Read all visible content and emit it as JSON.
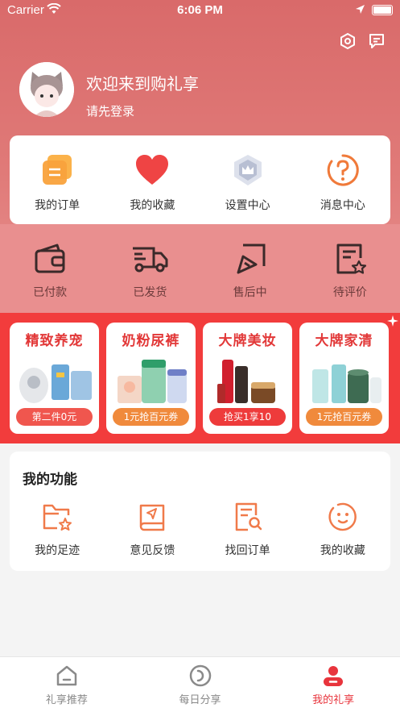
{
  "status_bar": {
    "carrier": "Carrier",
    "time": "6:06 PM"
  },
  "profile": {
    "welcome": "欢迎来到购礼享",
    "login_prompt": "请先登录"
  },
  "orders": [
    {
      "label": "我的订单",
      "icon": "orders-icon"
    },
    {
      "label": "我的收藏",
      "icon": "heart-icon"
    },
    {
      "label": "设置中心",
      "icon": "crown-shield-icon"
    },
    {
      "label": "消息中心",
      "icon": "question-icon"
    }
  ],
  "order_status": [
    {
      "label": "已付款",
      "icon": "wallet-icon"
    },
    {
      "label": "已发货",
      "icon": "truck-icon"
    },
    {
      "label": "售后中",
      "icon": "return-icon"
    },
    {
      "label": "待评价",
      "icon": "review-icon"
    }
  ],
  "promos": [
    {
      "title": "精致养宠",
      "tag": "第二件0元",
      "tag_color": "#f0564e"
    },
    {
      "title": "奶粉尿裤",
      "tag": "1元抢百元券",
      "tag_color": "#f08a3c"
    },
    {
      "title": "大牌美妆",
      "tag": "抢买1享10",
      "tag_color": "#ee3b3b"
    },
    {
      "title": "大牌家清",
      "tag": "1元抢百元券",
      "tag_color": "#f08a3c"
    }
  ],
  "features": {
    "title": "我的功能",
    "items": [
      {
        "label": "我的足迹",
        "icon": "folder-star-icon"
      },
      {
        "label": "意见反馈",
        "icon": "feedback-book-icon"
      },
      {
        "label": "找回订单",
        "icon": "search-document-icon"
      },
      {
        "label": "我的收藏",
        "icon": "smile-icon"
      }
    ]
  },
  "tabs": [
    {
      "label": "礼享推荐",
      "icon": "home-icon",
      "active": false
    },
    {
      "label": "每日分享",
      "icon": "share-circle-icon",
      "active": false
    },
    {
      "label": "我的礼享",
      "icon": "profile-icon",
      "active": true
    }
  ],
  "colors": {
    "accent": "#e8343c",
    "header": "#d96a6a",
    "promo_bg": "#f23c3c",
    "feature_icon": "#f07a4a"
  }
}
